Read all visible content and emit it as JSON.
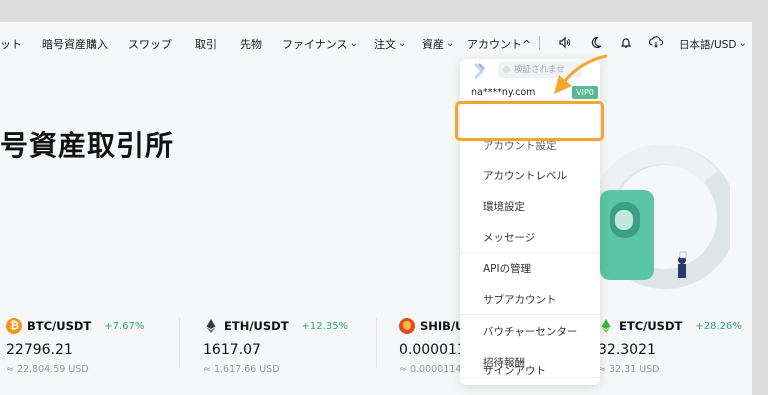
{
  "nav": {
    "items": [
      "ット",
      "暗号資産購入",
      "スワップ",
      "取引",
      "先物",
      "ファイナンス",
      "注文",
      "資産",
      "アカウント^"
    ],
    "lang": "日本語/USD"
  },
  "hero": {
    "title": "号資産取引所"
  },
  "menu": {
    "verify": "検証されませ",
    "email": "na****ny.com",
    "vip": "VIP0",
    "items": [
      "アカウント設定",
      "アカウントレベル",
      "環境設定",
      "メッセージ",
      "APIの管理",
      "サブアカウント",
      "バウチャーセンター",
      "招待報酬",
      "サインアウト"
    ]
  },
  "tickers": [
    {
      "pair": "BTC/USDT",
      "change": "+7.67%",
      "price": "22796.21",
      "sub": "≈ 22,804.59 USD",
      "color": "#f7931a"
    },
    {
      "pair": "ETH/USDT",
      "change": "+12.35%",
      "price": "1617.07",
      "sub": "≈ 1,617.66 USD",
      "color": "#3c3c3d"
    },
    {
      "pair": "SHIB/U",
      "change": "",
      "price": "0.000011",
      "sub": "≈ 0.0000114",
      "color": "#e64a19"
    },
    {
      "pair": "ETC/USDT",
      "change": "+28.26%",
      "price": "32.3021",
      "sub": "≈ 32.31 USD",
      "color": "#3ab83a"
    }
  ],
  "colors": {
    "accent": "#f7a531",
    "positive": "#2fa66f",
    "vip": "#5ab893"
  }
}
